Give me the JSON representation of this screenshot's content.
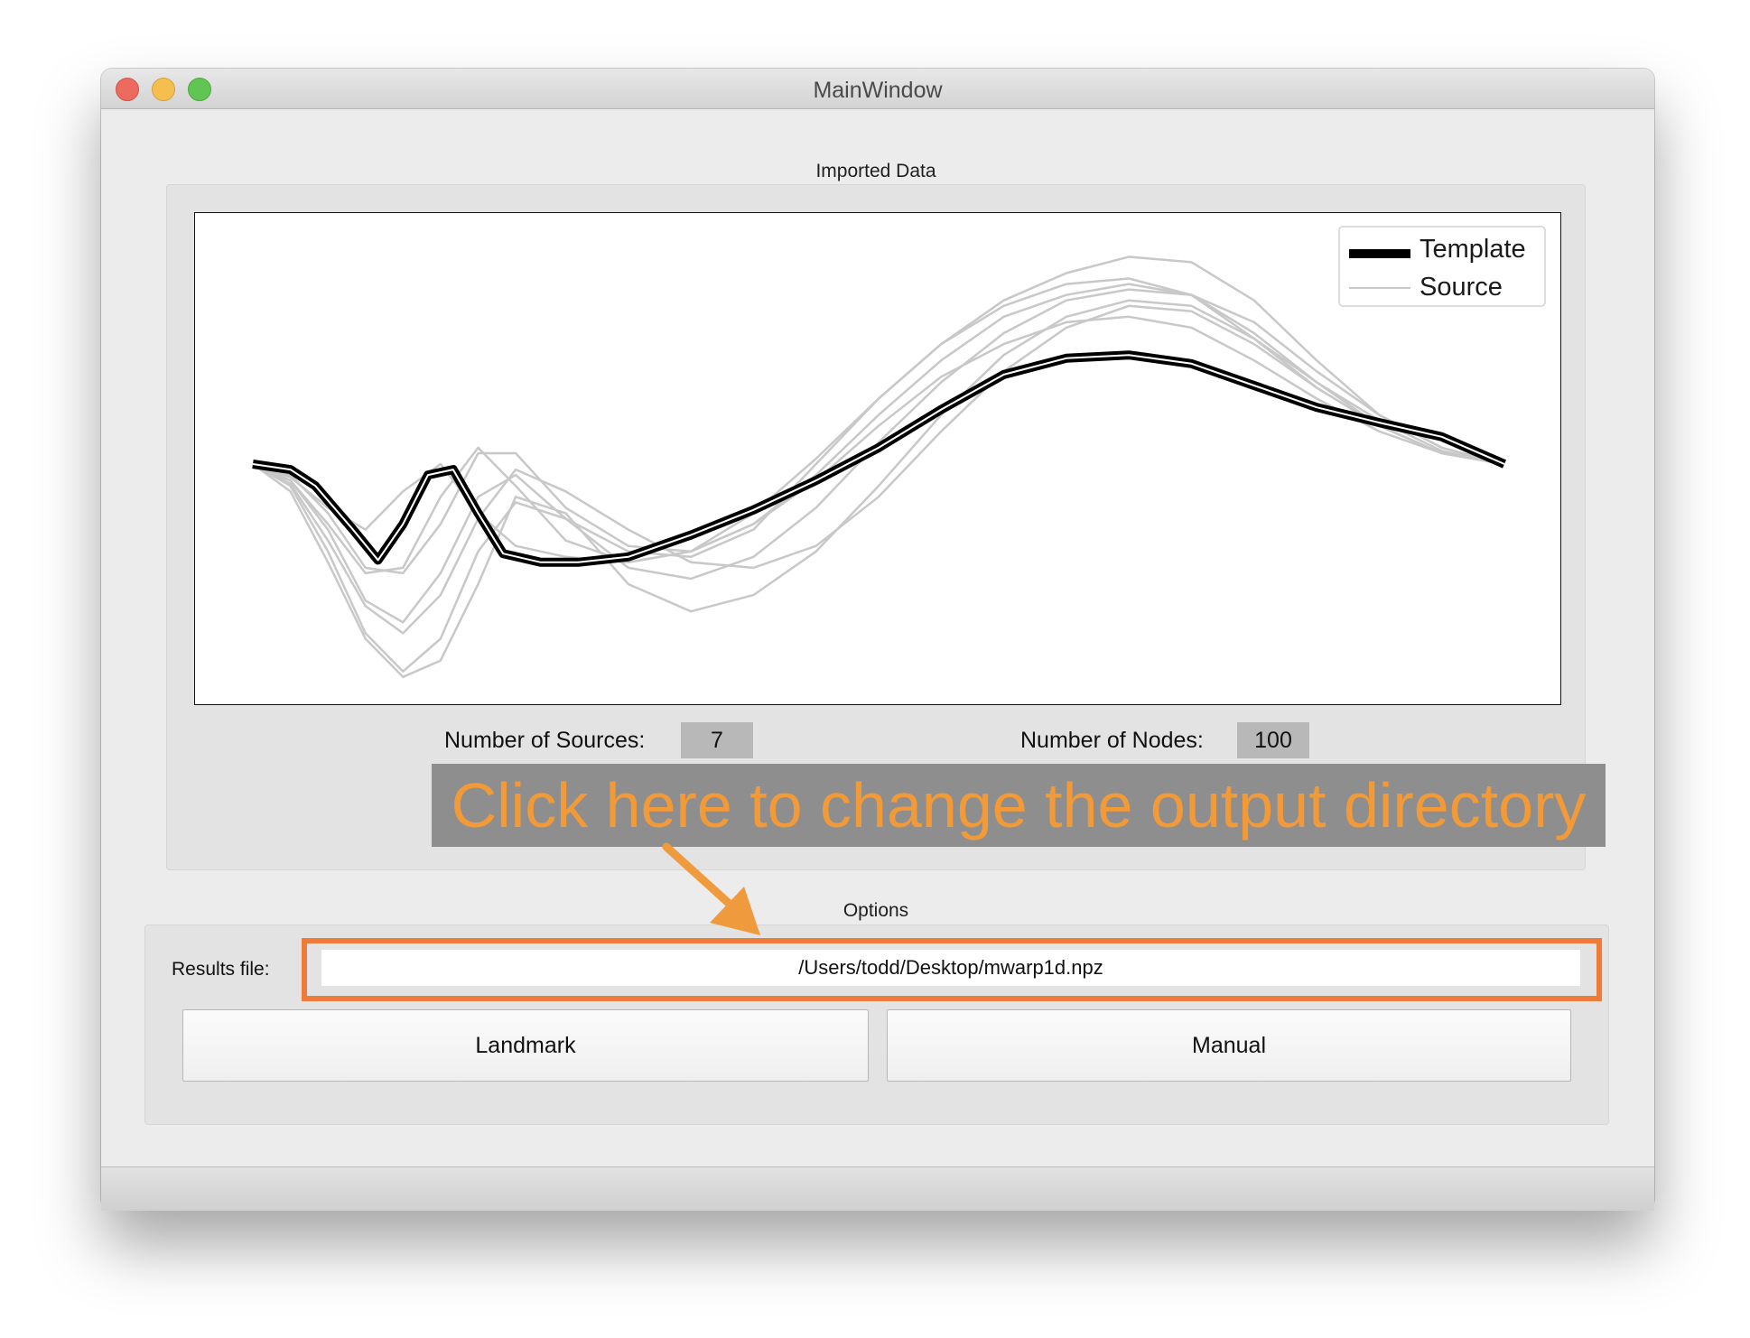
{
  "window": {
    "title": "MainWindow"
  },
  "imported_data": {
    "group_title": "Imported Data",
    "legend": [
      {
        "label": "Template",
        "color": "#000000"
      },
      {
        "label": "Source",
        "color": "#c8c8c8"
      }
    ],
    "num_sources_label": "Number of Sources:",
    "num_sources_value": "7",
    "num_nodes_label": "Number of Nodes:",
    "num_nodes_value": "100"
  },
  "annotation": {
    "text": "Click here to change the output directory",
    "color": "#f39a38"
  },
  "options": {
    "group_title": "Options",
    "results_label": "Results file:",
    "results_value": "/Users/todd/Desktop/mwarp1d.npz",
    "landmark_label": "Landmark",
    "manual_label": "Manual"
  },
  "chart_data": {
    "type": "line",
    "x_range": [
      0,
      100
    ],
    "series": [
      {
        "name": "Template",
        "color": "#000000",
        "x": [
          0,
          3,
          5,
          8,
          10,
          12,
          14,
          16,
          18,
          20,
          23,
          26,
          30,
          35,
          40,
          45,
          50,
          55,
          60,
          65,
          70,
          75,
          80,
          85,
          90,
          95,
          100
        ],
        "y": [
          0.0,
          -0.05,
          -0.2,
          -0.6,
          -0.88,
          -0.55,
          -0.1,
          -0.05,
          -0.45,
          -0.82,
          -0.9,
          -0.9,
          -0.85,
          -0.65,
          -0.42,
          -0.15,
          0.15,
          0.5,
          0.82,
          0.97,
          1.0,
          0.92,
          0.72,
          0.52,
          0.38,
          0.25,
          0.0
        ]
      },
      {
        "name": "Source 1",
        "color": "#c8c8c8",
        "x": [
          0,
          3,
          6,
          9,
          12,
          15,
          18,
          21,
          25,
          30,
          35,
          40,
          45,
          50,
          55,
          60,
          65,
          70,
          75,
          80,
          85,
          90,
          95,
          100
        ],
        "y": [
          0.0,
          -0.2,
          -0.8,
          -1.55,
          -1.9,
          -1.6,
          -0.8,
          -0.35,
          -0.5,
          -0.8,
          -0.85,
          -0.6,
          0.0,
          0.6,
          1.1,
          1.5,
          1.75,
          1.9,
          1.85,
          1.5,
          0.95,
          0.45,
          0.15,
          0.0
        ]
      },
      {
        "name": "Source 2",
        "color": "#c8c8c8",
        "x": [
          0,
          3,
          6,
          9,
          12,
          15,
          18,
          21,
          25,
          30,
          35,
          40,
          45,
          50,
          55,
          60,
          65,
          70,
          75,
          80,
          85,
          90,
          95,
          100
        ],
        "y": [
          0.0,
          -0.15,
          -0.6,
          -1.25,
          -1.45,
          -1.0,
          -0.3,
          -0.1,
          -0.5,
          -0.95,
          -1.05,
          -0.85,
          -0.4,
          0.2,
          0.75,
          1.2,
          1.5,
          1.6,
          1.55,
          1.3,
          0.85,
          0.45,
          0.15,
          0.0
        ]
      },
      {
        "name": "Source 3",
        "color": "#c8c8c8",
        "x": [
          0,
          3,
          6,
          9,
          12,
          15,
          18,
          21,
          25,
          30,
          35,
          40,
          45,
          50,
          55,
          60,
          65,
          70,
          75,
          80,
          85,
          90,
          95,
          100
        ],
        "y": [
          0.0,
          -0.25,
          -0.9,
          -1.6,
          -1.95,
          -1.8,
          -1.1,
          -0.3,
          -0.45,
          -1.1,
          -1.35,
          -1.2,
          -0.8,
          -0.2,
          0.45,
          1.0,
          1.35,
          1.5,
          1.45,
          1.15,
          0.75,
          0.4,
          0.12,
          0.0
        ]
      },
      {
        "name": "Source 4",
        "color": "#c8c8c8",
        "x": [
          0,
          3,
          6,
          9,
          12,
          15,
          18,
          21,
          25,
          30,
          35,
          40,
          45,
          50,
          55,
          60,
          65,
          70,
          75,
          80,
          85,
          90,
          95,
          100
        ],
        "y": [
          0.0,
          -0.1,
          -0.45,
          -0.95,
          -1.0,
          -0.55,
          0.1,
          0.1,
          -0.4,
          -0.75,
          -0.8,
          -0.55,
          -0.1,
          0.45,
          0.95,
          1.35,
          1.55,
          1.65,
          1.55,
          1.2,
          0.75,
          0.35,
          0.1,
          0.0
        ]
      },
      {
        "name": "Source 5",
        "color": "#c8c8c8",
        "x": [
          0,
          3,
          6,
          9,
          12,
          15,
          18,
          21,
          25,
          30,
          35,
          40,
          45,
          50,
          55,
          60,
          65,
          70,
          75,
          80,
          85,
          90,
          95,
          100
        ],
        "y": [
          0.0,
          -0.15,
          -0.55,
          -1.0,
          -0.95,
          -0.3,
          0.15,
          -0.2,
          -0.7,
          -0.9,
          -0.8,
          -0.45,
          0.05,
          0.6,
          1.1,
          1.45,
          1.65,
          1.7,
          1.55,
          1.15,
          0.7,
          0.35,
          0.1,
          0.0
        ]
      },
      {
        "name": "Source 6",
        "color": "#c8c8c8",
        "x": [
          0,
          3,
          6,
          9,
          12,
          15,
          18,
          21,
          25,
          30,
          35,
          40,
          45,
          50,
          55,
          60,
          65,
          70,
          75,
          80,
          85,
          90,
          95,
          100
        ],
        "y": [
          0.0,
          -0.12,
          -0.4,
          -0.6,
          -0.25,
          0.0,
          -0.45,
          -0.75,
          -0.85,
          -0.9,
          -0.8,
          -0.55,
          -0.15,
          0.35,
          0.8,
          1.1,
          1.3,
          1.35,
          1.25,
          0.95,
          0.6,
          0.3,
          0.1,
          0.0
        ]
      },
      {
        "name": "Source 7",
        "color": "#c8c8c8",
        "x": [
          0,
          3,
          6,
          9,
          12,
          15,
          18,
          21,
          25,
          30,
          35,
          40,
          45,
          50,
          55,
          60,
          65,
          70,
          75,
          80,
          85,
          90,
          95,
          100
        ],
        "y": [
          0.0,
          -0.18,
          -0.7,
          -1.3,
          -1.55,
          -1.2,
          -0.5,
          -0.05,
          -0.25,
          -0.6,
          -0.9,
          -0.95,
          -0.75,
          -0.3,
          0.3,
          0.85,
          1.25,
          1.45,
          1.4,
          1.1,
          0.7,
          0.35,
          0.1,
          0.0
        ]
      }
    ]
  }
}
